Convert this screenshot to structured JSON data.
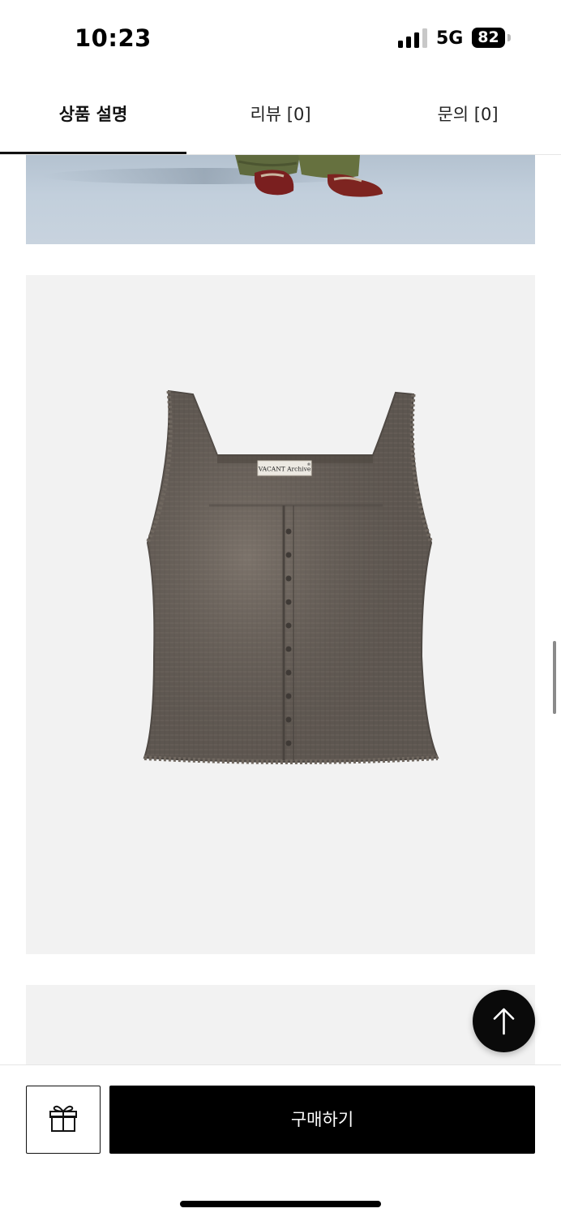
{
  "status_bar": {
    "time": "10:23",
    "network": "5G",
    "battery": "82",
    "signal_bars": 3,
    "signal_max": 4
  },
  "tabs": [
    {
      "label": "상품 설명",
      "active": true
    },
    {
      "label": "리뷰 [0]",
      "active": false
    },
    {
      "label": "문의 [0]",
      "active": false
    }
  ],
  "product": {
    "label_text": "VACANT Archive",
    "label_mark": "®",
    "garment_color": "#5d5650"
  },
  "bottom_bar": {
    "gift_icon": "gift-icon",
    "buy_label": "구매하기"
  },
  "floating": {
    "scroll_top_icon": "arrow-up-icon"
  },
  "colors": {
    "accent": "#000000",
    "image_background": "#f2f2f2"
  }
}
